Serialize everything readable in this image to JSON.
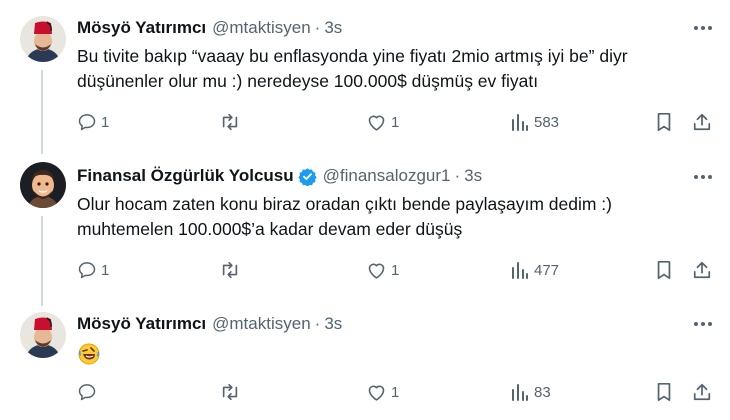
{
  "tweets": [
    {
      "author_name": "Mösyö Yatırımcı",
      "handle": "@mtaktisyen",
      "dot": "·",
      "time": "3s",
      "lines": [
        "Bu tivite bakıp “vaaay bu enflasyonda yine fiyatı 2mio artmış iyi be” diyr",
        "düşünenler olur mu :) neredeyse 100.000$ düşmüş ev fiyatı"
      ],
      "replies": "1",
      "retweets": "",
      "likes": "1",
      "views": "583",
      "avatar_icon": "fez-man-avatar"
    },
    {
      "author_name": "Finansal Özgürlük Yolcusu",
      "handle": "@finansalozgur1",
      "dot": "·",
      "time": "3s",
      "lines": [
        "Olur hocam zaten konu biraz oradan çıktı bende paylaşayım dedim :)",
        "muhtemelen 100.000$’a kadar devam eder düşüş"
      ],
      "replies": "1",
      "retweets": "",
      "likes": "1",
      "views": "477",
      "avatar_icon": "memoji-avatar",
      "verified": true
    },
    {
      "author_name": "Mösyö Yatırımcı",
      "handle": "@mtaktisyen",
      "dot": "·",
      "time": "3s",
      "lines": [],
      "emoji": "rolling-on-floor-laughing-emoji",
      "replies": "",
      "retweets": "",
      "likes": "1",
      "views": "83",
      "avatar_icon": "fez-man-avatar"
    }
  ],
  "colors": {
    "text": "#0f1419",
    "muted": "#536471",
    "thread_line": "#cfd9de",
    "verified_blue": "#1d9bf0",
    "fez_red": "#c8102e"
  }
}
